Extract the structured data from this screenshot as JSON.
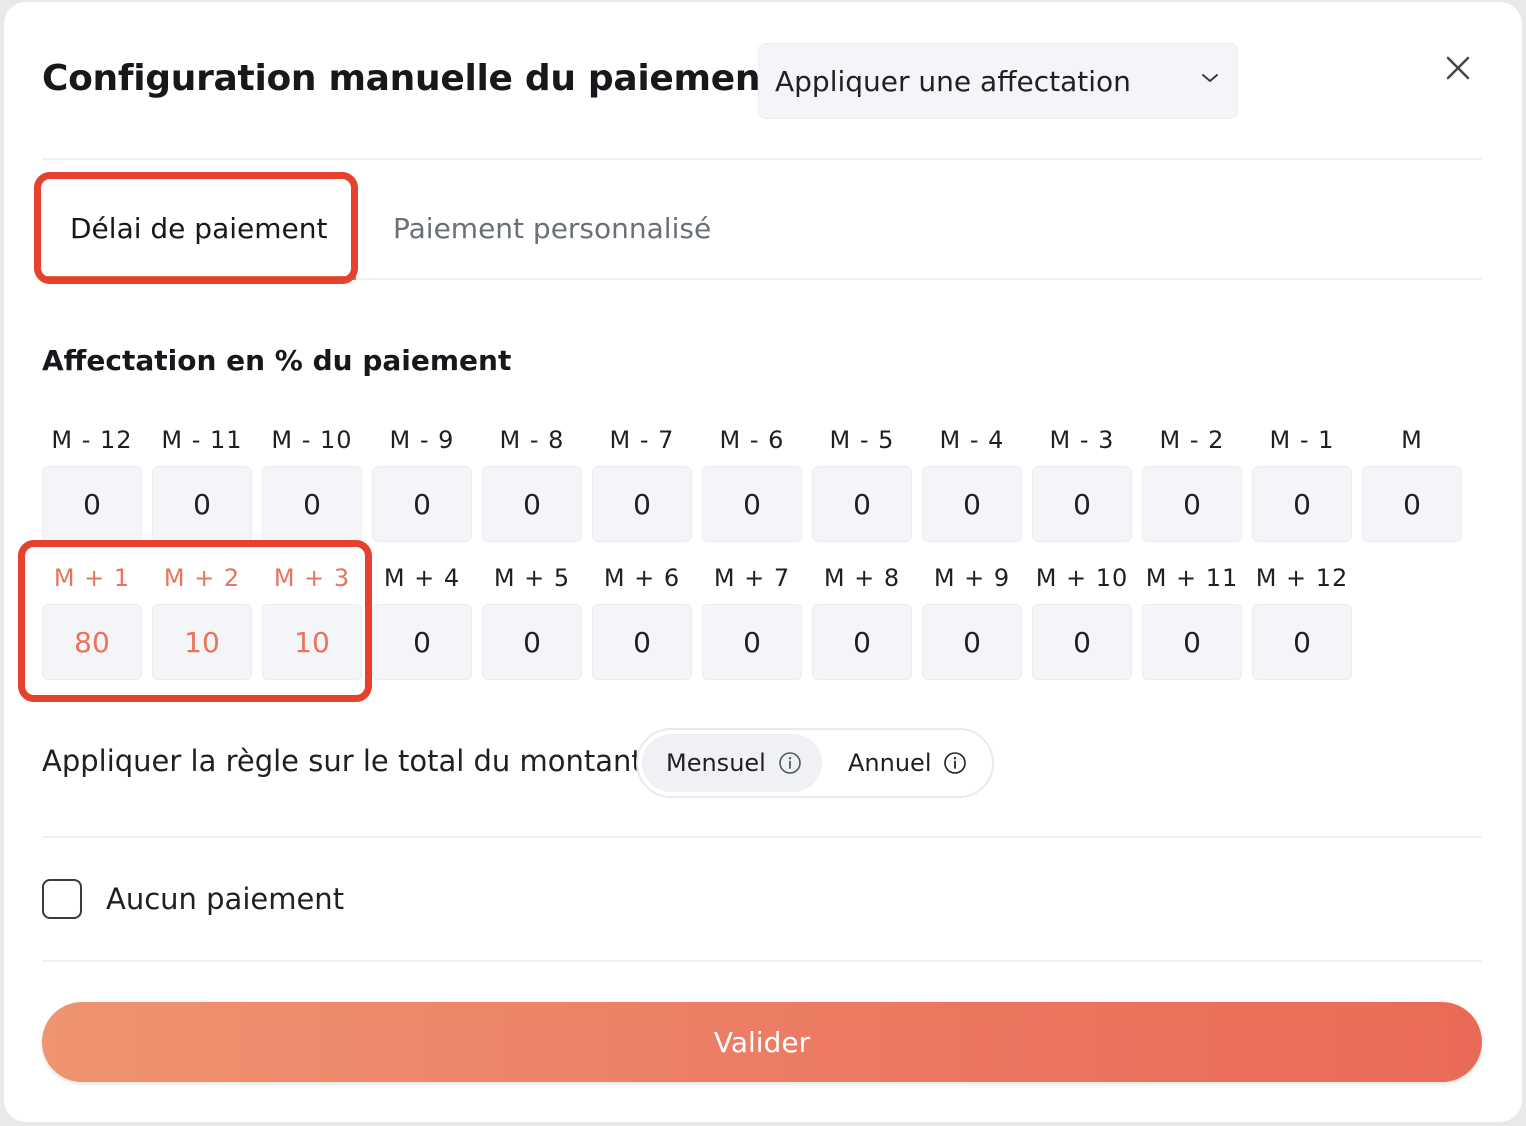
{
  "modal": {
    "title": "Configuration manuelle du paiement",
    "assignment_select": {
      "value": "Appliquer une affectation"
    }
  },
  "tabs": [
    {
      "label": "Délai de paiement",
      "active": true
    },
    {
      "label": "Paiement personnalisé",
      "active": false
    }
  ],
  "allocation": {
    "title": "Affectation en % du paiement",
    "row1": [
      {
        "label": "M - 12",
        "value": "0"
      },
      {
        "label": "M - 11",
        "value": "0"
      },
      {
        "label": "M - 10",
        "value": "0"
      },
      {
        "label": "M - 9",
        "value": "0"
      },
      {
        "label": "M - 8",
        "value": "0"
      },
      {
        "label": "M - 7",
        "value": "0"
      },
      {
        "label": "M - 6",
        "value": "0"
      },
      {
        "label": "M - 5",
        "value": "0"
      },
      {
        "label": "M - 4",
        "value": "0"
      },
      {
        "label": "M - 3",
        "value": "0"
      },
      {
        "label": "M - 2",
        "value": "0"
      },
      {
        "label": "M - 1",
        "value": "0"
      },
      {
        "label": "M",
        "value": "0"
      }
    ],
    "row2": [
      {
        "label": "M + 1",
        "value": "80",
        "highlighted": true
      },
      {
        "label": "M + 2",
        "value": "10",
        "highlighted": true
      },
      {
        "label": "M + 3",
        "value": "10",
        "highlighted": true
      },
      {
        "label": "M + 4",
        "value": "0"
      },
      {
        "label": "M + 5",
        "value": "0"
      },
      {
        "label": "M + 6",
        "value": "0"
      },
      {
        "label": "M + 7",
        "value": "0"
      },
      {
        "label": "M + 8",
        "value": "0"
      },
      {
        "label": "M + 9",
        "value": "0"
      },
      {
        "label": "M + 10",
        "value": "0"
      },
      {
        "label": "M + 11",
        "value": "0"
      },
      {
        "label": "M + 12",
        "value": "0"
      }
    ]
  },
  "rule": {
    "label": "Appliquer la règle sur le total du montant",
    "options": [
      {
        "label": "Mensuel",
        "selected": true,
        "icon": "info-icon"
      },
      {
        "label": "Annuel",
        "selected": false,
        "icon": "info-icon"
      }
    ]
  },
  "no_payment": {
    "label": "Aucun paiement",
    "checked": false
  },
  "submit": {
    "label": "Valider"
  },
  "colors": {
    "accent": "#e8745c",
    "highlight_border": "#e5412c",
    "field_bg": "#f4f5f8"
  }
}
